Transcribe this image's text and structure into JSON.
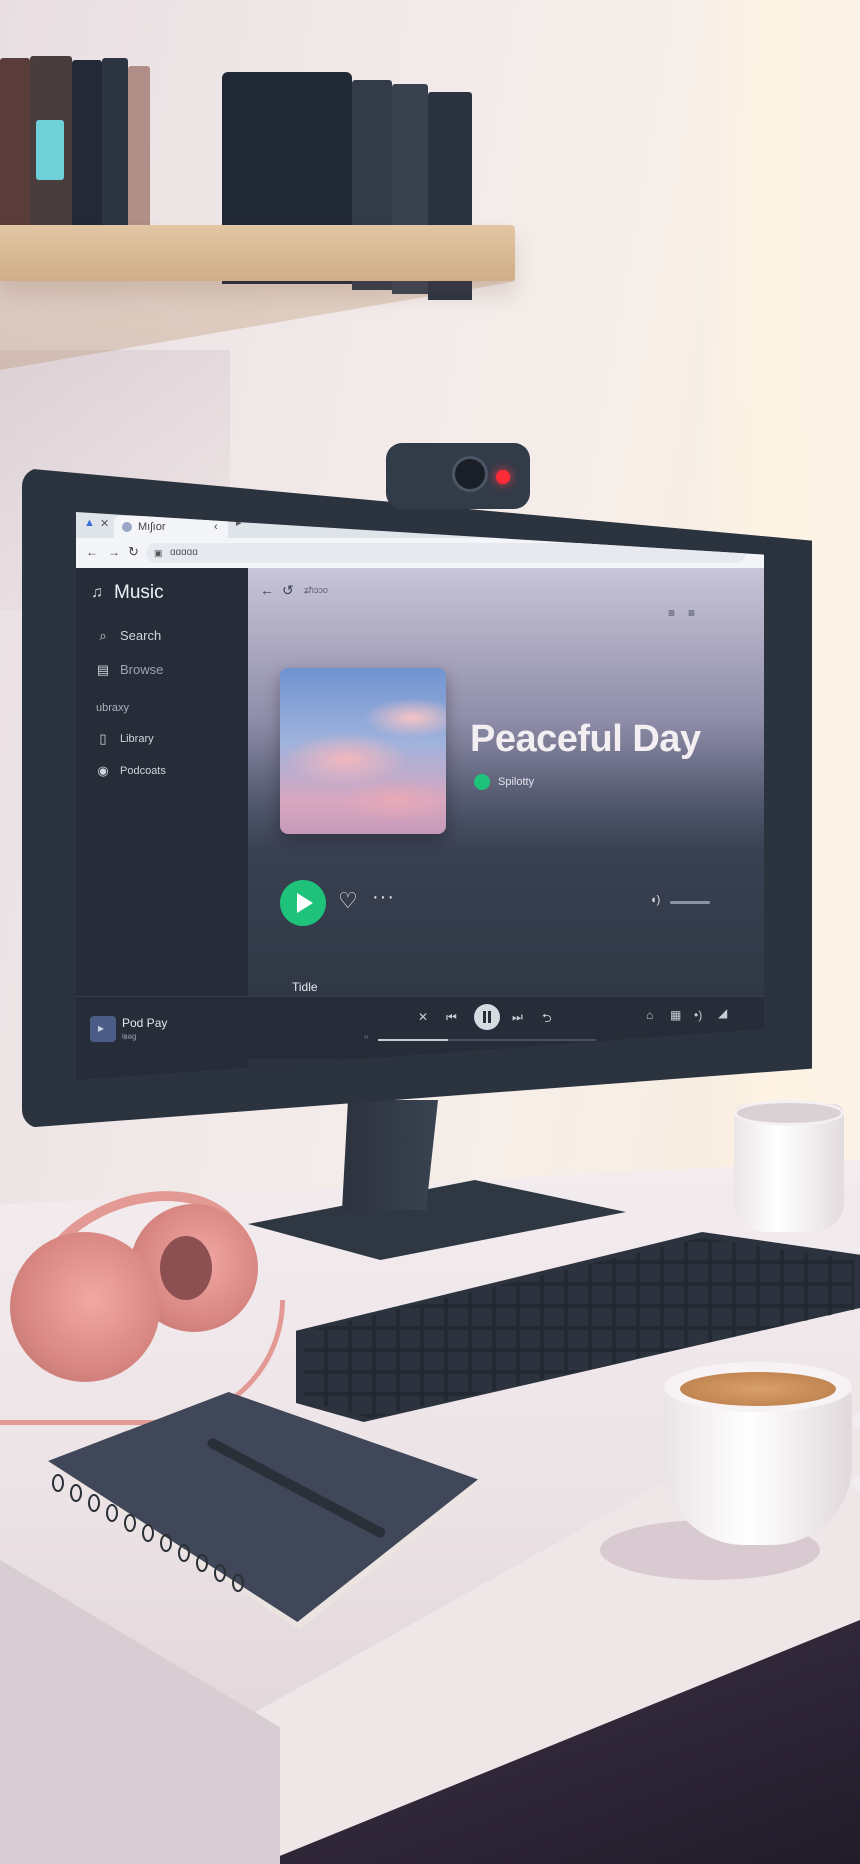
{
  "browser": {
    "tab_label": "Mıʃıor",
    "url_text": "ɑɑɑɑɑ",
    "inner_path": "ʑħɔɔo"
  },
  "sidebar": {
    "app_title": "Music",
    "items": [
      {
        "label": "Search"
      },
      {
        "label": "Browse"
      },
      {
        "label": "ubraxy"
      },
      {
        "label": "Library"
      },
      {
        "label": "Podcoats"
      }
    ],
    "now_playing": {
      "title": "Pod Pay",
      "subtitle": "ʲʙəɡ"
    }
  },
  "main": {
    "track_title": "Peaceful Day",
    "artist": "Spilotty",
    "column_header": "Tidle"
  },
  "colors": {
    "accent": "#1ec27b",
    "sidebar_bg": "#262d38",
    "recording_light": "#ff2b37"
  }
}
